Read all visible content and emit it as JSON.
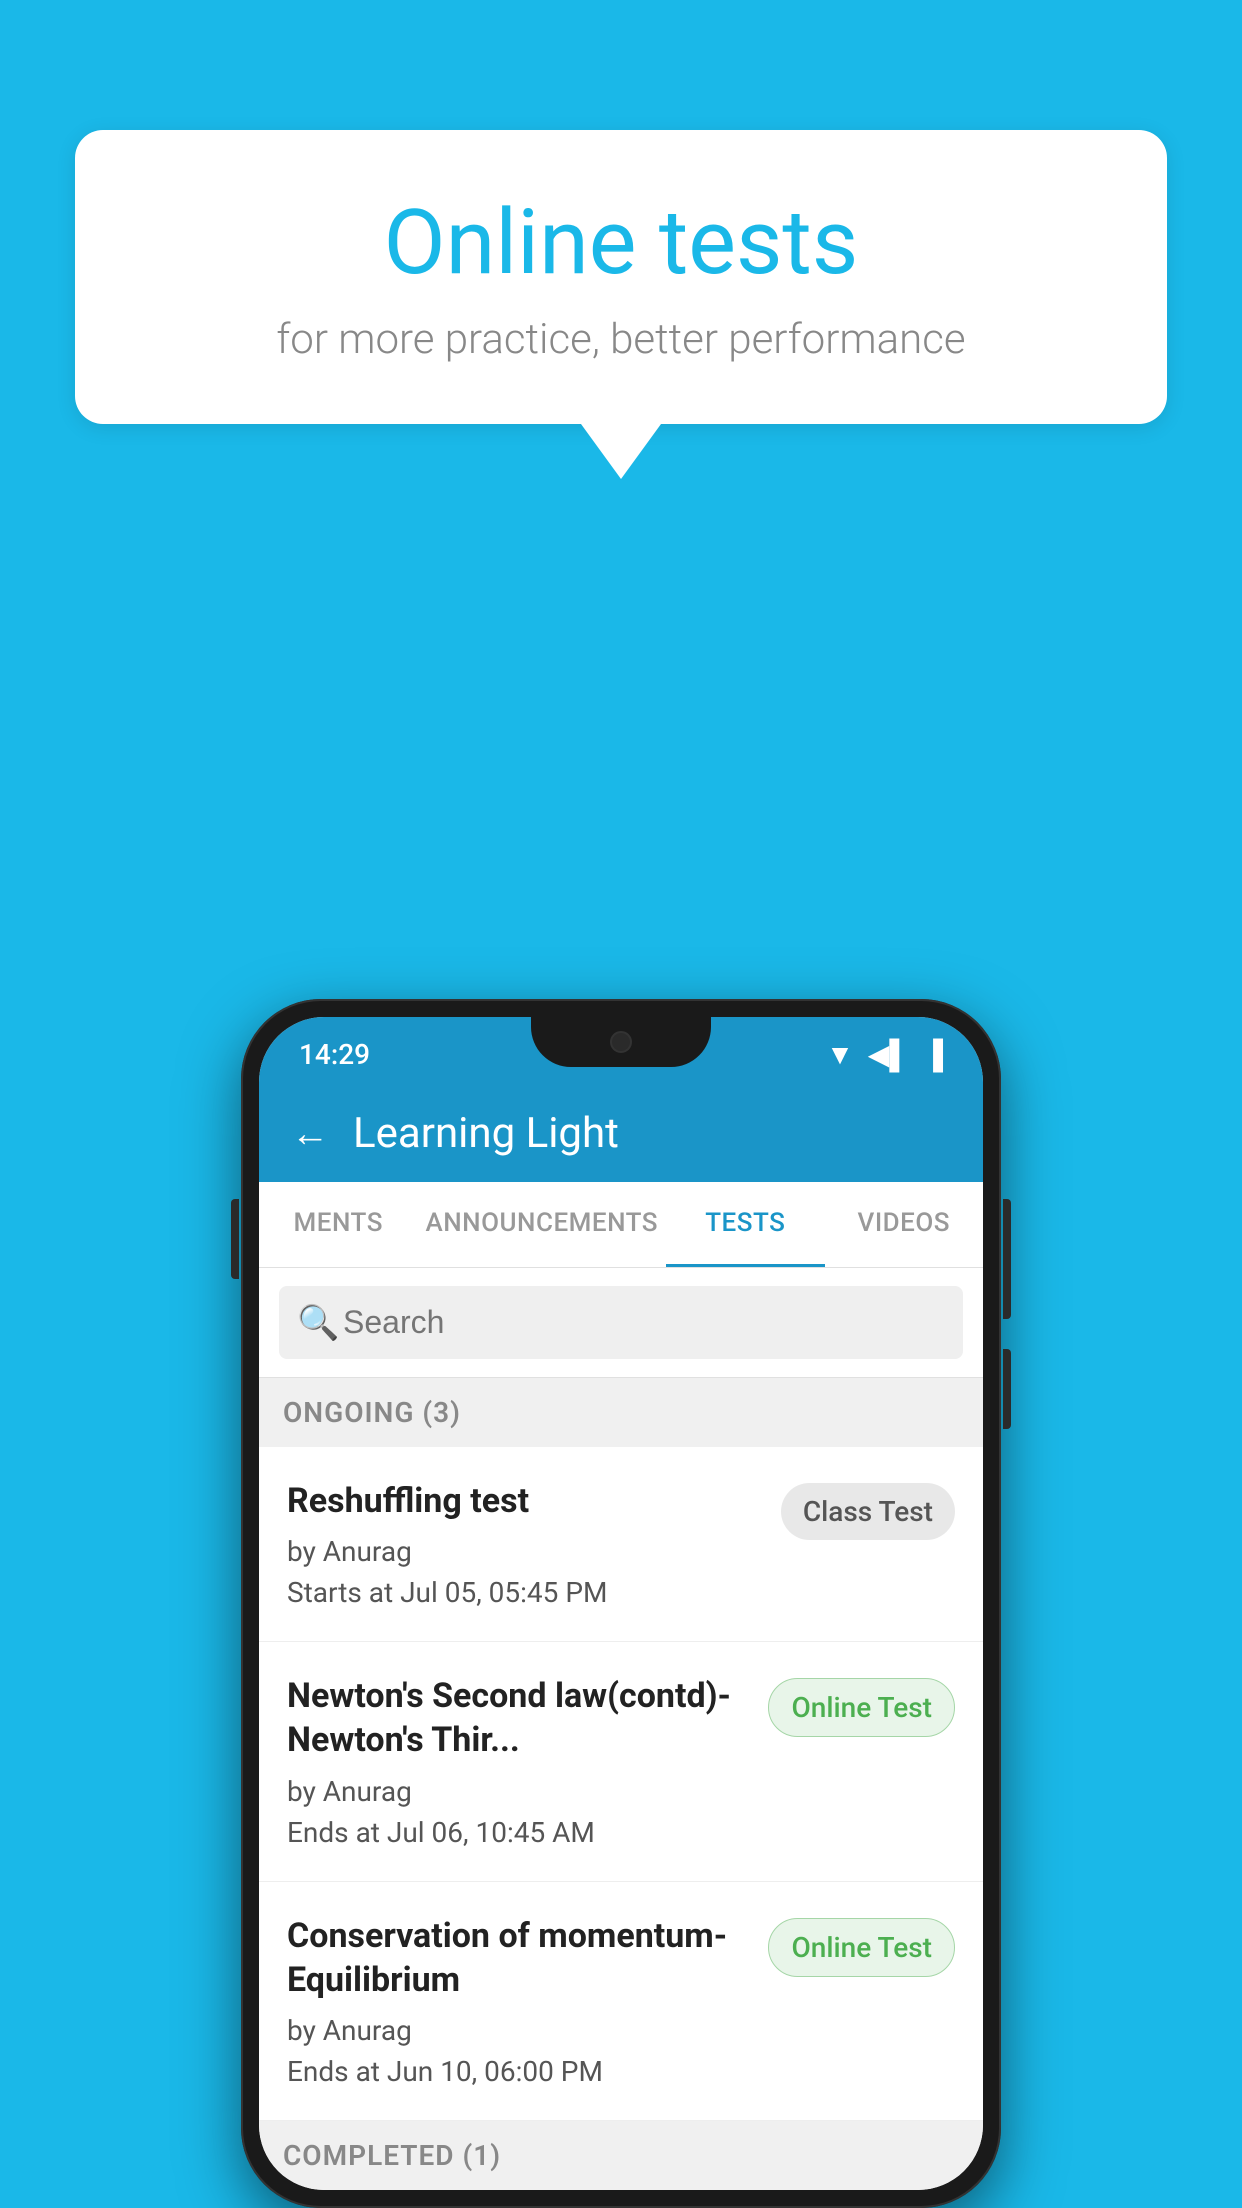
{
  "background_color": "#1ab8e8",
  "speech_bubble": {
    "title": "Online tests",
    "subtitle": "for more practice, better performance"
  },
  "phone": {
    "status_bar": {
      "time": "14:29",
      "icons": [
        "wifi",
        "signal",
        "battery"
      ]
    },
    "header": {
      "back_label": "←",
      "title": "Learning Light"
    },
    "tabs": [
      {
        "label": "MENTS",
        "active": false
      },
      {
        "label": "ANNOUNCEMENTS",
        "active": false
      },
      {
        "label": "TESTS",
        "active": true
      },
      {
        "label": "VIDEOS",
        "active": false
      }
    ],
    "search": {
      "placeholder": "Search"
    },
    "ongoing_section": {
      "label": "ONGOING (3)"
    },
    "tests": [
      {
        "title": "Reshuffling test",
        "author": "by Anurag",
        "date": "Starts at  Jul 05, 05:45 PM",
        "badge": "Class Test",
        "badge_type": "class"
      },
      {
        "title": "Newton's Second law(contd)-Newton's Thir...",
        "author": "by Anurag",
        "date": "Ends at  Jul 06, 10:45 AM",
        "badge": "Online Test",
        "badge_type": "online"
      },
      {
        "title": "Conservation of momentum-Equilibrium",
        "author": "by Anurag",
        "date": "Ends at  Jun 10, 06:00 PM",
        "badge": "Online Test",
        "badge_type": "online"
      }
    ],
    "completed_section": {
      "label": "COMPLETED (1)"
    }
  }
}
